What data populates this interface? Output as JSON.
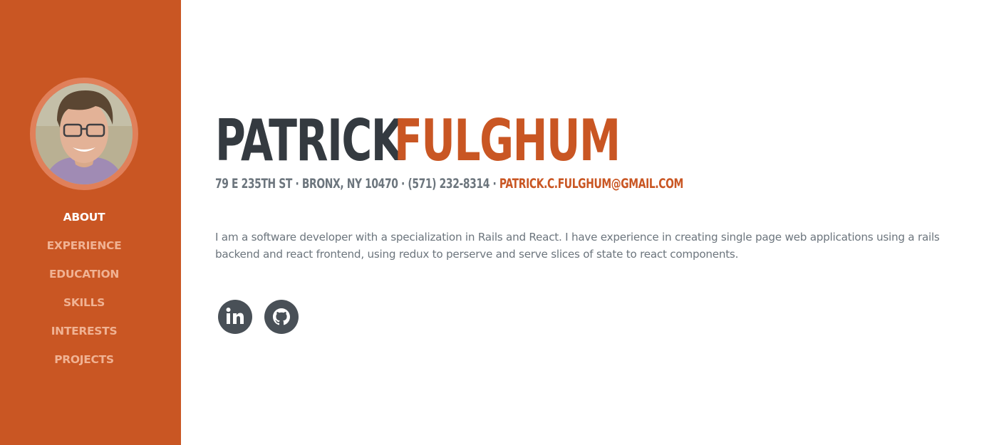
{
  "colors": {
    "primary": "#c95623",
    "dark": "#343a40",
    "muted": "#6c757d",
    "nav_inactive": "#f0b293",
    "icon_bg": "#495057"
  },
  "sidebar": {
    "avatar_alt": "profile photo",
    "nav": [
      {
        "label": "ABOUT",
        "active": true
      },
      {
        "label": "EXPERIENCE",
        "active": false
      },
      {
        "label": "EDUCATION",
        "active": false
      },
      {
        "label": "SKILLS",
        "active": false
      },
      {
        "label": "INTERESTS",
        "active": false
      },
      {
        "label": "PROJECTS",
        "active": false
      }
    ]
  },
  "header": {
    "first_name": "PATRICK",
    "last_name": "FULGHUM",
    "address": "79 E 235TH ST · BRONX, NY 10470 · (571) 232-8314 · ",
    "email": "PATRICK.C.FULGHUM@GMAIL.COM"
  },
  "about": {
    "text": "I am a software developer with a specialization in Rails and React. I have experience in creating single page web applications using a rails backend and react frontend, using redux to perserve and serve slices of state to react components."
  },
  "social": [
    {
      "name": "linkedin-icon"
    },
    {
      "name": "github-icon"
    }
  ]
}
